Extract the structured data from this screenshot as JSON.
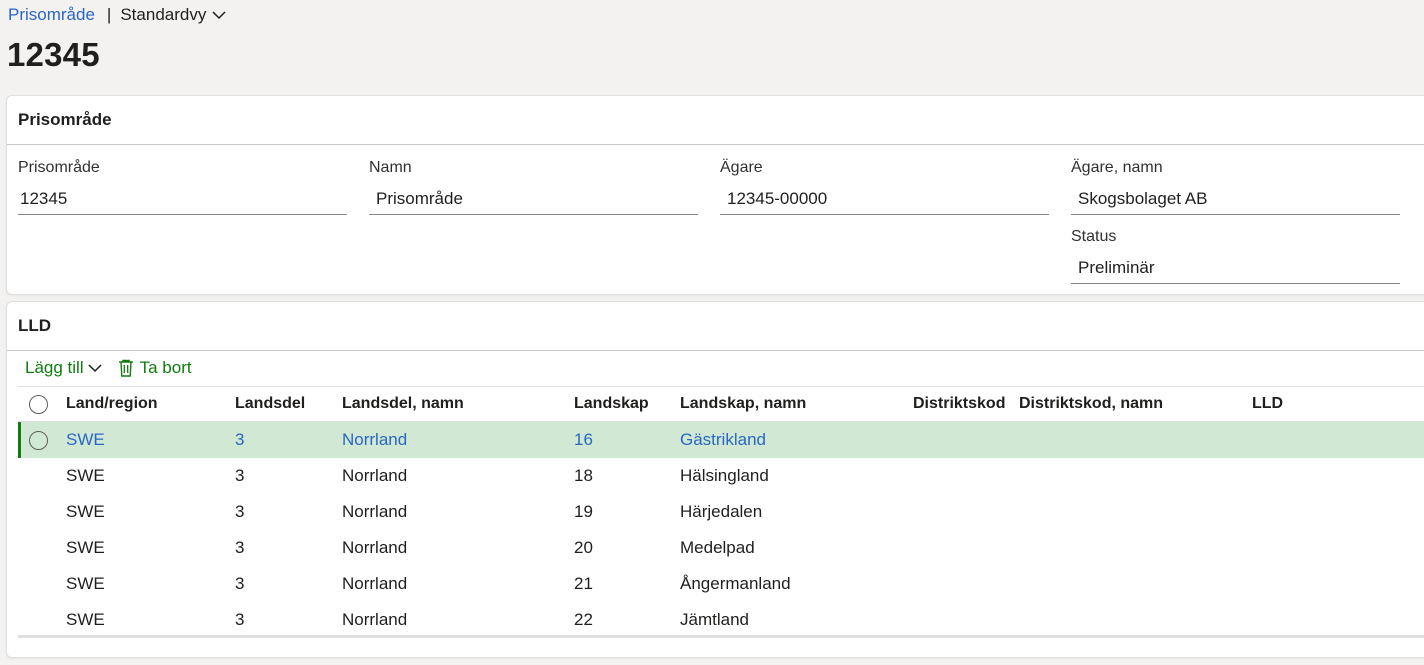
{
  "breadcrumb": {
    "link": "Prisområde",
    "separator": "|",
    "view": "Standardvy"
  },
  "title": "12345",
  "general": {
    "header": "Prisområde",
    "fields": [
      {
        "label": "Prisområde",
        "value": "12345"
      },
      {
        "label": "Namn",
        "value": "Prisområde"
      },
      {
        "label": "Ägare",
        "value": "12345-00000"
      },
      {
        "label": "Ägare, namn",
        "value": "Skogsbolaget AB"
      },
      {
        "label": "Status",
        "value": "Preliminär"
      }
    ]
  },
  "lld": {
    "header": "LLD",
    "toolbar": {
      "add": "Lägg till",
      "remove": "Ta bort"
    },
    "columns": [
      "Land/region",
      "Landsdel",
      "Landsdel, namn",
      "Landskap",
      "Landskap, namn",
      "Distriktskod",
      "Distriktskod, namn",
      "LLD"
    ],
    "rows": [
      [
        "SWE",
        "3",
        "Norrland",
        "16",
        "Gästrikland",
        "",
        "",
        ""
      ],
      [
        "SWE",
        "3",
        "Norrland",
        "18",
        "Hälsingland",
        "",
        "",
        ""
      ],
      [
        "SWE",
        "3",
        "Norrland",
        "19",
        "Härjedalen",
        "",
        "",
        ""
      ],
      [
        "SWE",
        "3",
        "Norrland",
        "20",
        "Medelpad",
        "",
        "",
        ""
      ],
      [
        "SWE",
        "3",
        "Norrland",
        "21",
        "Ångermanland",
        "",
        "",
        ""
      ],
      [
        "SWE",
        "3",
        "Norrland",
        "22",
        "Jämtland",
        "",
        "",
        ""
      ]
    ],
    "selected_row": 0
  },
  "colors": {
    "accent": "#107c10",
    "link": "#2a67c3",
    "selected_row": "#d1e8d4"
  }
}
